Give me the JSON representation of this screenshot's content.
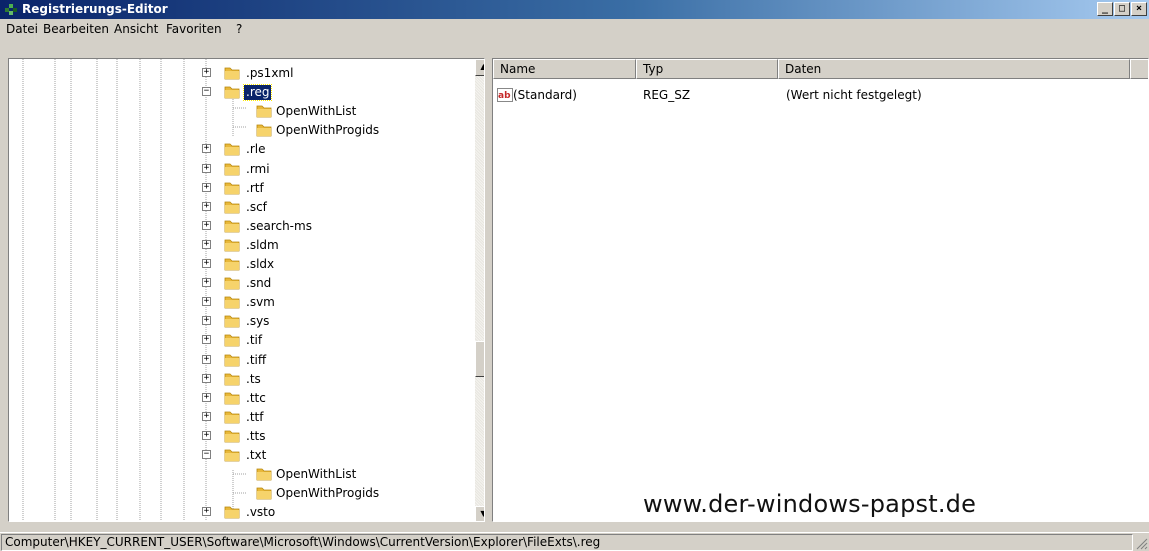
{
  "window": {
    "title": "Registrierungs-Editor",
    "controls": [
      "_",
      "□",
      "×"
    ]
  },
  "menu": [
    "Datei",
    "Bearbeiten",
    "Ansicht",
    "Favoriten",
    "?"
  ],
  "tree": {
    "items": [
      {
        "label": ".ps1xml",
        "expander": "+",
        "level": 0
      },
      {
        "label": ".reg",
        "expander": "−",
        "level": 0,
        "selected": true
      },
      {
        "label": "OpenWithList",
        "level": 1
      },
      {
        "label": "OpenWithProgids",
        "level": 1
      },
      {
        "label": ".rle",
        "expander": "+",
        "level": 0
      },
      {
        "label": ".rmi",
        "expander": "+",
        "level": 0
      },
      {
        "label": ".rtf",
        "expander": "+",
        "level": 0
      },
      {
        "label": ".scf",
        "expander": "+",
        "level": 0
      },
      {
        "label": ".search-ms",
        "expander": "+",
        "level": 0
      },
      {
        "label": ".sldm",
        "expander": "+",
        "level": 0
      },
      {
        "label": ".sldx",
        "expander": "+",
        "level": 0
      },
      {
        "label": ".snd",
        "expander": "+",
        "level": 0
      },
      {
        "label": ".svm",
        "expander": "+",
        "level": 0
      },
      {
        "label": ".sys",
        "expander": "+",
        "level": 0
      },
      {
        "label": ".tif",
        "expander": "+",
        "level": 0
      },
      {
        "label": ".tiff",
        "expander": "+",
        "level": 0
      },
      {
        "label": ".ts",
        "expander": "+",
        "level": 0
      },
      {
        "label": ".ttc",
        "expander": "+",
        "level": 0
      },
      {
        "label": ".ttf",
        "expander": "+",
        "level": 0
      },
      {
        "label": ".tts",
        "expander": "+",
        "level": 0
      },
      {
        "label": ".txt",
        "expander": "−",
        "level": 0
      },
      {
        "label": "OpenWithList",
        "level": 1
      },
      {
        "label": "OpenWithProgids",
        "level": 1
      },
      {
        "label": ".vsto",
        "expander": "+",
        "level": 0
      }
    ]
  },
  "list": {
    "columns": [
      "Name",
      "Typ",
      "Daten"
    ],
    "rows": [
      {
        "name": "(Standard)",
        "type": "REG_SZ",
        "data": "(Wert nicht festgelegt)",
        "icon": "string-value-icon"
      }
    ]
  },
  "watermark": "www.der-windows-papst.de",
  "status": "Computer\\HKEY_CURRENT_USER\\Software\\Microsoft\\Windows\\CurrentVersion\\Explorer\\FileExts\\.reg",
  "colors": {
    "title_active": "#0a246a",
    "selection": "#0a246a",
    "folder": "#e8b83a"
  }
}
